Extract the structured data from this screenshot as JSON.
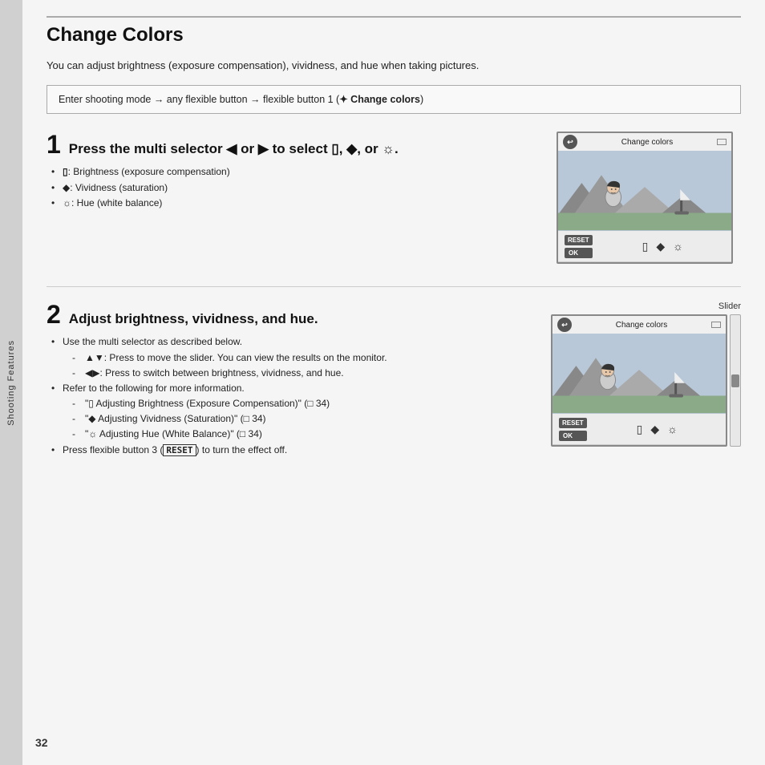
{
  "sidebar": {
    "label": "Shooting Features"
  },
  "page": {
    "title": "Change Colors",
    "page_number": "32",
    "intro": "You can adjust brightness (exposure compensation), vividness, and hue when taking pictures.",
    "instruction_box": "Enter shooting mode → any flexible button → flexible button 1 (🌸 Change colors)",
    "steps": [
      {
        "number": "1",
        "title": "Press the multi selector ◀ or ▶ to select 🖼, ◆, or 🔆.",
        "bullets": [
          "🖼: Brightness (exposure compensation)",
          "◆: Vividness (saturation)",
          "🔆: Hue (white balance)"
        ],
        "sub_bullets": []
      },
      {
        "number": "2",
        "title": "Adjust brightness, vividness, and hue.",
        "bullets": [
          "Use the multi selector as described below."
        ],
        "sub_items": [
          "▲▼: Press to move the slider. You can view the results on the monitor.",
          "◀▶: Press to switch between brightness, vividness, and hue."
        ],
        "bullets2": [
          "Refer to the following for more information."
        ],
        "sub_items2": [
          "\"🖼 Adjusting Brightness (Exposure Compensation)\" (📖 34)",
          "\"◆ Adjusting Vividness (Saturation)\" (📖 34)",
          "\"🔆 Adjusting Hue (White Balance)\" (📖 34)"
        ],
        "bullets3": [
          "Press flexible button 3 (RESET) to turn the effect off."
        ],
        "slider_label": "Slider"
      }
    ]
  }
}
